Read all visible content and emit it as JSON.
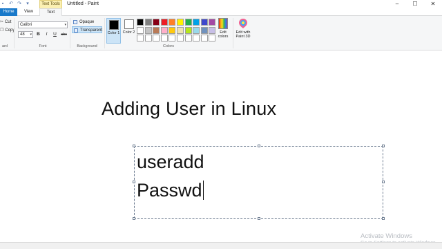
{
  "window": {
    "title": "Untitled - Paint",
    "context_tab_title": "Text Tools",
    "controls": [
      "–",
      "☐",
      "✕"
    ]
  },
  "quick_access": [
    "save-icon",
    "undo-icon",
    "redo-icon",
    "customize-icon"
  ],
  "tabs": [
    {
      "label": "Home",
      "active": false
    },
    {
      "label": "View",
      "active": false
    },
    {
      "label": "Text",
      "active": true
    }
  ],
  "ribbon": {
    "clipboard": {
      "label": "ard",
      "cut": "Cut",
      "copy": "Copy"
    },
    "font": {
      "label": "Font",
      "family": "Calibri",
      "size": "48",
      "bold": "B",
      "italic": "I",
      "underline": "U",
      "strike": "abc"
    },
    "background": {
      "label": "Background",
      "opaque": "Opaque",
      "transparent": "Transparent",
      "selected": "Transparent"
    },
    "colors": {
      "label": "Colors",
      "color1_label": "Color 1",
      "color2_label": "Color 2",
      "color1": "#000000",
      "color2": "#ffffff",
      "palette": [
        "#000000",
        "#7f7f7f",
        "#880015",
        "#ed1c24",
        "#ff7f27",
        "#fff200",
        "#22b14c",
        "#00a2e8",
        "#3f48cc",
        "#a349a4",
        "#ffffff",
        "#c3c3c3",
        "#b97a57",
        "#ffaec9",
        "#ffc90e",
        "#efe4b0",
        "#b5e61d",
        "#99d9ea",
        "#7092be",
        "#c8bfe7",
        "#ffffff",
        "#ffffff",
        "#ffffff",
        "#ffffff",
        "#ffffff",
        "#ffffff",
        "#ffffff",
        "#ffffff",
        "#ffffff",
        "#ffffff"
      ],
      "edit_colors": "Edit colors",
      "edit_paint3d": "Edit with Paint 3D"
    }
  },
  "canvas": {
    "heading": "Adding User in Linux",
    "textbox_lines": [
      "useradd",
      "Passwd"
    ]
  },
  "watermark": {
    "line1": "Activate Windows",
    "line2": "Go to Settings to activate Windows."
  }
}
